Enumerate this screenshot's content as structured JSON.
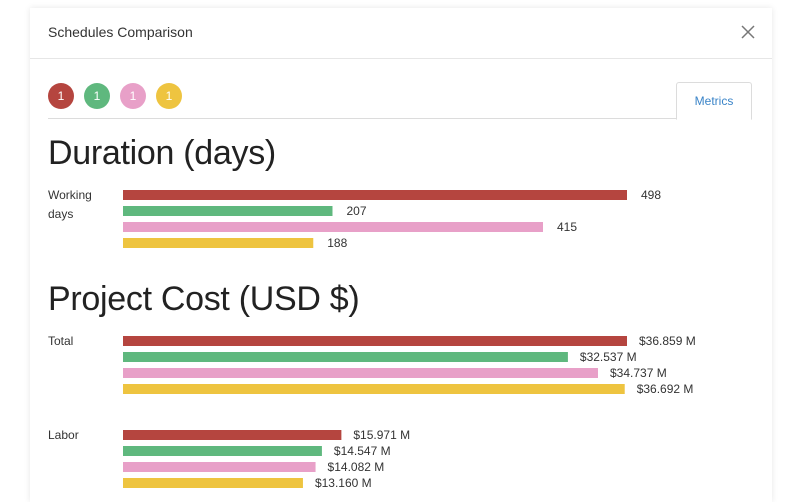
{
  "dialog": {
    "title": "Schedules Comparison"
  },
  "schedules": [
    {
      "label": "1",
      "color": "#b5453f"
    },
    {
      "label": "1",
      "color": "#5fb87e"
    },
    {
      "label": "1",
      "color": "#e8a0c8"
    },
    {
      "label": "1",
      "color": "#eec440"
    }
  ],
  "tabs": {
    "metrics_label": "Metrics"
  },
  "sections": {
    "duration_title": "Duration (days)",
    "cost_title": "Project Cost (USD $)"
  },
  "chart_data": [
    {
      "type": "bar",
      "title": "Duration (days)",
      "categories": [
        "Working days"
      ],
      "series": [
        {
          "color": "#b5453f",
          "values": [
            498
          ],
          "labels": [
            "498"
          ]
        },
        {
          "color": "#5fb87e",
          "values": [
            207
          ],
          "labels": [
            "207"
          ]
        },
        {
          "color": "#e8a0c8",
          "values": [
            415
          ],
          "labels": [
            "415"
          ]
        },
        {
          "color": "#eec440",
          "values": [
            188
          ],
          "labels": [
            "188"
          ]
        }
      ]
    },
    {
      "type": "bar",
      "title": "Project Cost (USD $)",
      "categories": [
        "Total",
        "Labor"
      ],
      "series": [
        {
          "color": "#b5453f",
          "values": [
            36.859,
            15.971
          ],
          "labels": [
            "$36.859 M",
            "$15.971 M"
          ]
        },
        {
          "color": "#5fb87e",
          "values": [
            32.537,
            14.547
          ],
          "labels": [
            "$32.537 M",
            "$14.547 M"
          ]
        },
        {
          "color": "#e8a0c8",
          "values": [
            34.737,
            14.082
          ],
          "labels": [
            "$34.737 M",
            "$14.082 M"
          ]
        },
        {
          "color": "#eec440",
          "values": [
            36.692,
            13.16
          ],
          "labels": [
            "$36.692 M",
            "$13.160 M"
          ]
        }
      ]
    }
  ]
}
